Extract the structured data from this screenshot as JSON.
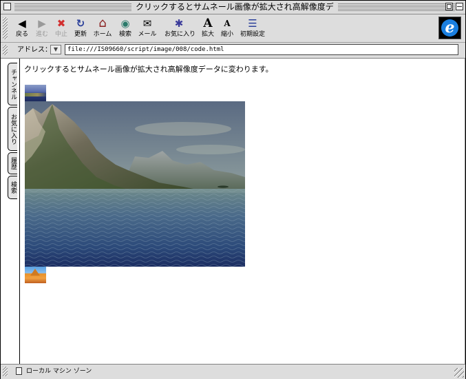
{
  "window": {
    "title": "クリックするとサムネール画像が拡大され高解像度デ"
  },
  "toolbar": {
    "buttons": [
      {
        "label": "戻る",
        "icon": "back-arrow-icon",
        "glyph": "◀",
        "color": "#333333"
      },
      {
        "label": "進む",
        "icon": "forward-arrow-icon",
        "glyph": "▶",
        "color": "#9a9a9a"
      },
      {
        "label": "中止",
        "icon": "stop-icon",
        "glyph": "✖",
        "color": "#d23030"
      },
      {
        "label": "更新",
        "icon": "refresh-icon",
        "glyph": "↻",
        "color": "#2a3f9a"
      },
      {
        "label": "ホーム",
        "icon": "home-icon",
        "glyph": "⌂",
        "color": "#8a2020"
      },
      {
        "label": "検索",
        "icon": "search-icon",
        "glyph": "◉",
        "color": "#2a7a6a"
      },
      {
        "label": "メール",
        "icon": "mail-icon",
        "glyph": "✉",
        "color": "#333333"
      },
      {
        "label": "お気に入り",
        "icon": "favorites-icon",
        "glyph": "✱",
        "color": "#3a3a9a"
      },
      {
        "label": "拡大",
        "icon": "larger-text-icon",
        "glyph": "A",
        "color": "#000000"
      },
      {
        "label": "縮小",
        "icon": "smaller-text-icon",
        "glyph": "A",
        "color": "#000000"
      },
      {
        "label": "初期設定",
        "icon": "preferences-icon",
        "glyph": "☰",
        "color": "#2a3f9a"
      }
    ]
  },
  "address": {
    "label": "アドレス：",
    "value": "file:///IS09660/script/image/008/code.html"
  },
  "explorer_tabs": [
    "チャンネル",
    "お気に入り",
    "履歴",
    "検索"
  ],
  "page": {
    "text": "クリックするとサムネール画像が拡大され高解像度データに変わります。"
  },
  "status": {
    "zone": "ローカル マシン ゾーン"
  }
}
